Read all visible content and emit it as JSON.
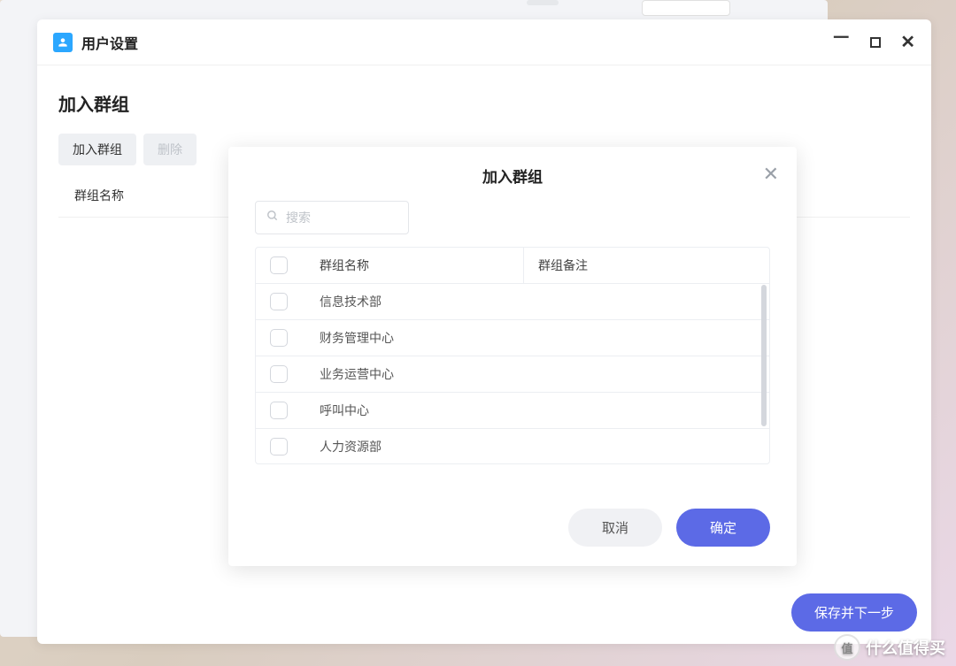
{
  "window": {
    "title": "用户设置"
  },
  "page": {
    "title": "加入群组",
    "toolbar": {
      "join": "加入群组",
      "delete": "删除"
    },
    "column_header": "群组名称",
    "save_button": "保存并下一步"
  },
  "modal": {
    "title": "加入群组",
    "search_placeholder": "搜索",
    "columns": {
      "name": "群组名称",
      "note": "群组备注"
    },
    "rows": [
      {
        "name": "信息技术部"
      },
      {
        "name": "财务管理中心"
      },
      {
        "name": "业务运营中心"
      },
      {
        "name": "呼叫中心"
      },
      {
        "name": "人力资源部"
      }
    ],
    "cancel": "取消",
    "confirm": "确定"
  },
  "watermark": "什么值得买"
}
